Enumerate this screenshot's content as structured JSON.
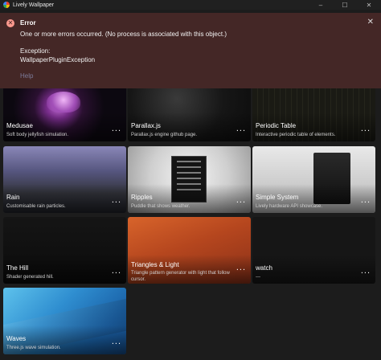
{
  "window": {
    "title": "Lively Wallpaper",
    "minimize": "–",
    "maximize": "☐",
    "close": "✕"
  },
  "error": {
    "icon": "error-icon",
    "title": "Error",
    "message": "One or more errors occurred. (No process is associated with this object.)",
    "exception_label": "Exception:",
    "exception_value": "WallpaperPluginException",
    "help": "Help",
    "close": "✕",
    "colors": {
      "background": "#442726",
      "icon": "#ff9a8f",
      "link": "#7c7b9a"
    }
  },
  "tiles": [
    {
      "title": "Medusae",
      "desc": "Soft body jellyfish simulation.",
      "more": "..."
    },
    {
      "title": "Parallax.js",
      "desc": "Parallax.js engine github page.",
      "more": "..."
    },
    {
      "title": "Periodic Table",
      "desc": "Interactive periodic table of elements.",
      "more": "..."
    },
    {
      "title": "Rain",
      "desc": "Customisable rain particles.",
      "more": "..."
    },
    {
      "title": "Ripples",
      "desc": "Puddle that shows weather.",
      "more": "..."
    },
    {
      "title": "Simple System",
      "desc": "Lively hardware API showcase.",
      "more": "..."
    },
    {
      "title": "The Hill",
      "desc": "Shader generated hill.",
      "more": "..."
    },
    {
      "title": "Triangles & Light",
      "desc": "Triangle pattern generator with light that follow cursor.",
      "more": "..."
    },
    {
      "title": "watch",
      "desc": "---",
      "more": "..."
    },
    {
      "title": "Waves",
      "desc": "Three.js wave simulation.",
      "more": "..."
    }
  ]
}
